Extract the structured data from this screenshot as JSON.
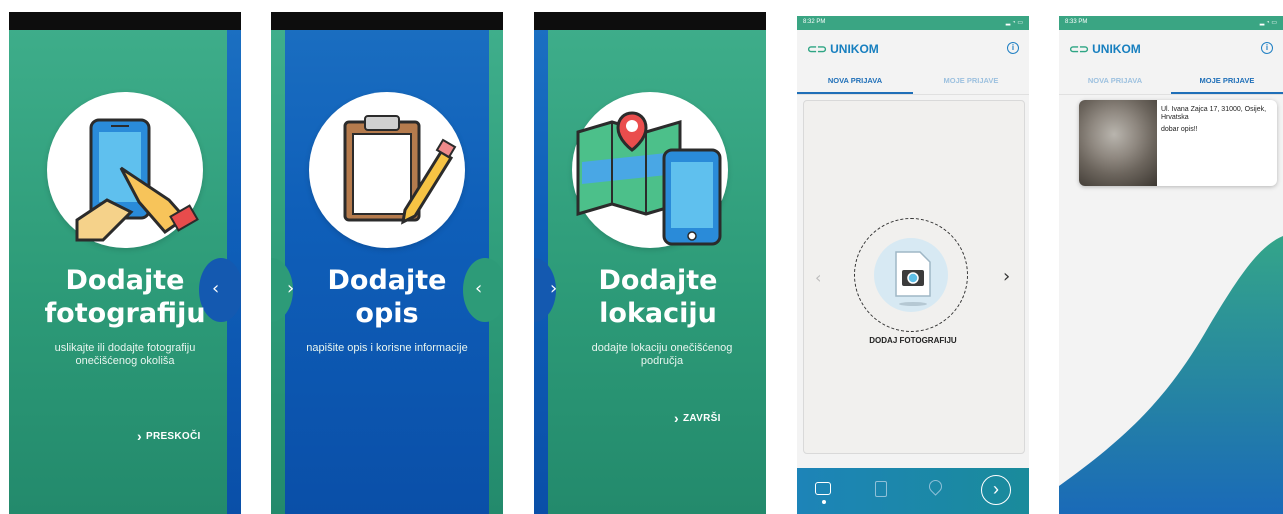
{
  "onboarding": [
    {
      "title_line1": "Dodajte",
      "title_line2": "fotografiju",
      "description": "uslikajte ili dodajte fotografiju onečišćenog okoliša",
      "action": "PRESKOČI",
      "illustration": "hand-phone-icon"
    },
    {
      "title_line1": "Dodajte",
      "title_line2": "opis",
      "description": "napišite opis i korisne informacije",
      "illustration": "clipboard-pencil-icon"
    },
    {
      "title_line1": "Dodajte",
      "title_line2": "lokaciju",
      "description": "dodajte lokaciju onečišćenog područja",
      "action": "ZAVRŠI",
      "illustration": "map-phone-icon"
    }
  ],
  "app_new": {
    "status_time": "8:32 PM",
    "brand": "UNIKOM",
    "tabs": [
      "NOVA PRIJAVA",
      "MOJE PRIJAVE"
    ],
    "add_photo_label": "DODAJ FOTOGRAFIJU",
    "nav_icons": [
      "camera-icon",
      "document-icon",
      "location-icon",
      "next-icon"
    ]
  },
  "app_reports": {
    "status_time": "8:33 PM",
    "brand": "UNIKOM",
    "tabs": [
      "NOVA PRIJAVA",
      "MOJE PRIJAVE"
    ],
    "report": {
      "address": "Ul. Ivana Zajca 17, 31000, Osijek, Hrvatska",
      "description": "dobar opis!!"
    }
  },
  "colors": {
    "green": "#2d9b78",
    "blue": "#0f5fb9",
    "brand_blue": "#1f6fb8"
  }
}
